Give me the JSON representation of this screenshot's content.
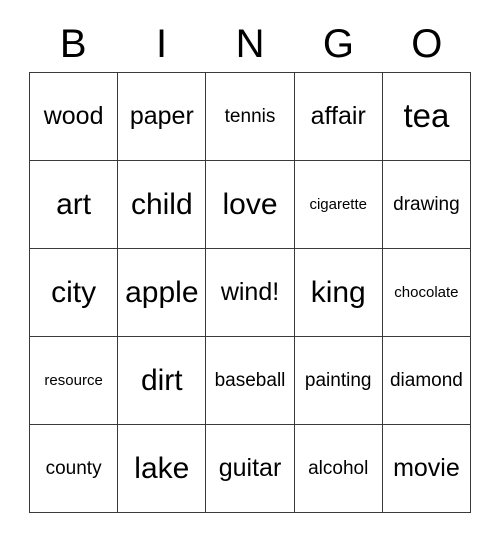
{
  "card": {
    "headers": [
      "B",
      "I",
      "N",
      "G",
      "O"
    ],
    "rows": [
      [
        {
          "text": "wood",
          "size": "md"
        },
        {
          "text": "paper",
          "size": "md"
        },
        {
          "text": "tennis",
          "size": "sm"
        },
        {
          "text": "affair",
          "size": "md"
        },
        {
          "text": "tea",
          "size": "xl"
        }
      ],
      [
        {
          "text": "art",
          "size": "lg"
        },
        {
          "text": "child",
          "size": "lg"
        },
        {
          "text": "love",
          "size": "lg"
        },
        {
          "text": "cigarette",
          "size": "xs"
        },
        {
          "text": "drawing",
          "size": "sm"
        }
      ],
      [
        {
          "text": "city",
          "size": "lg"
        },
        {
          "text": "apple",
          "size": "lg"
        },
        {
          "text": "wind!",
          "size": "md"
        },
        {
          "text": "king",
          "size": "lg"
        },
        {
          "text": "chocolate",
          "size": "xs"
        }
      ],
      [
        {
          "text": "resource",
          "size": "xs"
        },
        {
          "text": "dirt",
          "size": "lg"
        },
        {
          "text": "baseball",
          "size": "sm"
        },
        {
          "text": "painting",
          "size": "sm"
        },
        {
          "text": "diamond",
          "size": "sm"
        }
      ],
      [
        {
          "text": "county",
          "size": "sm"
        },
        {
          "text": "lake",
          "size": "lg"
        },
        {
          "text": "guitar",
          "size": "md"
        },
        {
          "text": "alcohol",
          "size": "sm"
        },
        {
          "text": "movie",
          "size": "md"
        }
      ]
    ],
    "colors": {
      "text": "#000000",
      "grid_line": "#3a3a3a",
      "background": "#ffffff"
    }
  }
}
